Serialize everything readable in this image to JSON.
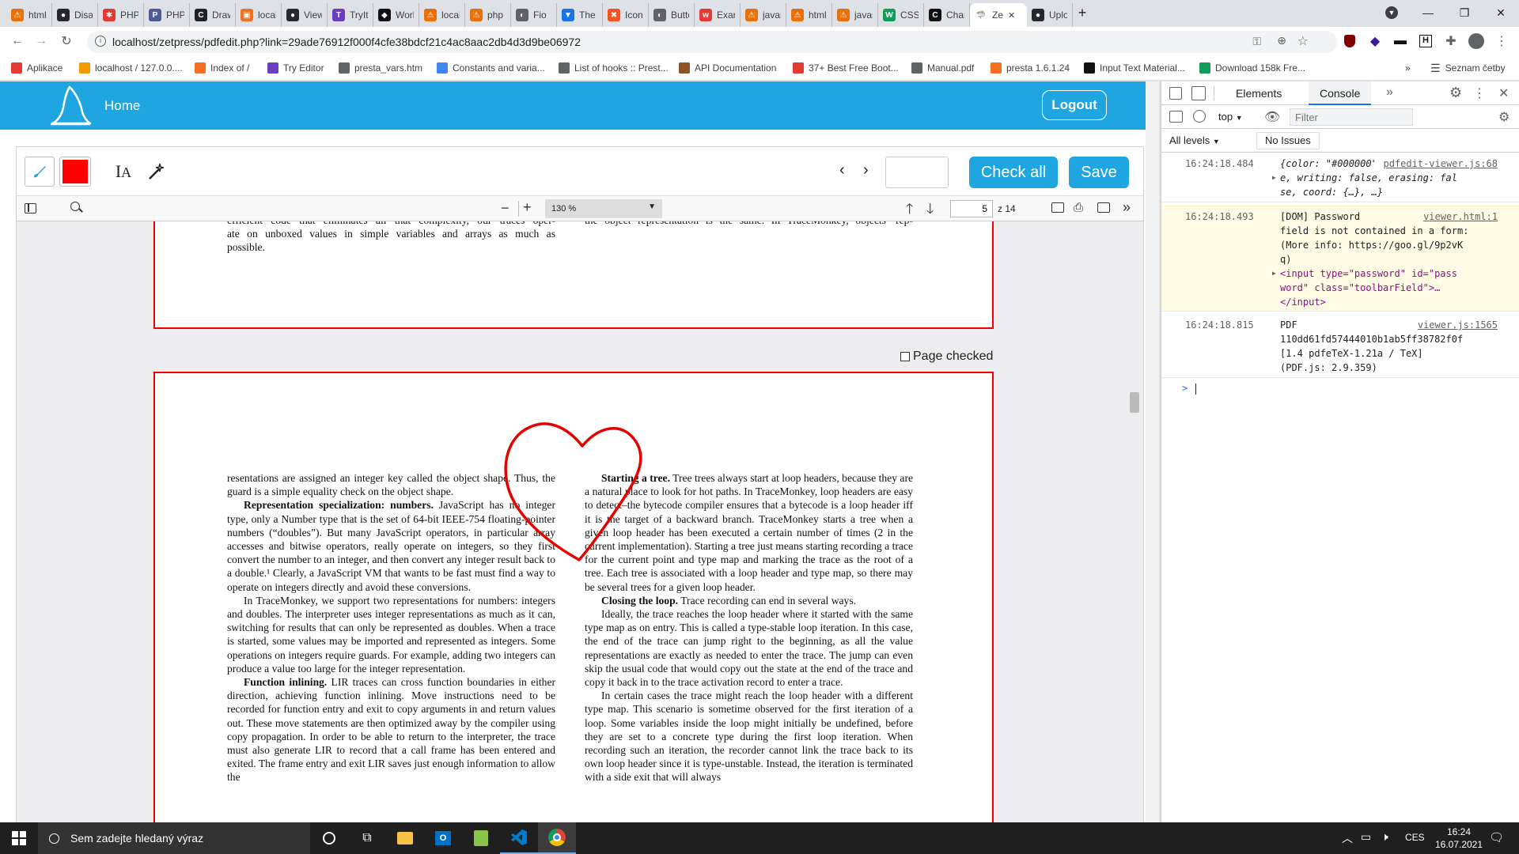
{
  "browser": {
    "tabs": [
      {
        "label": "html -",
        "fav": "#e8710a",
        "glyph": "⚠"
      },
      {
        "label": "Disab",
        "fav": "#24292e",
        "glyph": "●"
      },
      {
        "label": "PHP is",
        "fav": "#e53935",
        "glyph": "✱"
      },
      {
        "label": "PHP: I",
        "fav": "#4f5b93",
        "glyph": "P"
      },
      {
        "label": "Draw",
        "fav": "#202124",
        "glyph": "C"
      },
      {
        "label": "localh",
        "fav": "#f36f21",
        "glyph": "▣"
      },
      {
        "label": "Viewe",
        "fav": "#24292e",
        "glyph": "●"
      },
      {
        "label": "TryIt E",
        "fav": "#6a3fbf",
        "glyph": "T"
      },
      {
        "label": "Worki",
        "fav": "#111111",
        "glyph": "◆"
      },
      {
        "label": "localh",
        "fav": "#e8710a",
        "glyph": "⚠"
      },
      {
        "label": "php -",
        "fav": "#e8710a",
        "glyph": "⚠"
      },
      {
        "label": "Fio",
        "fav": "#5f6368",
        "glyph": "◐"
      },
      {
        "label": "The B",
        "fav": "#1a73e8",
        "glyph": "▼"
      },
      {
        "label": "Icons",
        "fav": "#f4511e",
        "glyph": "✖"
      },
      {
        "label": "Butto",
        "fav": "#5f6368",
        "glyph": "◐"
      },
      {
        "label": "Examp",
        "fav": "#e53935",
        "glyph": "w"
      },
      {
        "label": "javasc",
        "fav": "#e8710a",
        "glyph": "⚠"
      },
      {
        "label": "html -",
        "fav": "#e8710a",
        "glyph": "⚠"
      },
      {
        "label": "javasc",
        "fav": "#e8710a",
        "glyph": "⚠"
      },
      {
        "label": "CSS c",
        "fav": "#0f9d58",
        "glyph": "W"
      },
      {
        "label": "Chang",
        "fav": "#111111",
        "glyph": "C"
      },
      {
        "label": "Ze",
        "fav": "#ffffff",
        "glyph": "🦈",
        "active": true
      },
      {
        "label": "Uploa",
        "fav": "#24292e",
        "glyph": "●"
      }
    ],
    "new_tab": "+",
    "url": "localhost/zetpress/pdfedit.php?link=29ade76912f000f4cfe38bdcf21c4ac8aac2db4d3d9be06972",
    "bookmarks": [
      {
        "label": "Aplikace",
        "color": "#e53935"
      },
      {
        "label": "localhost / 127.0.0....",
        "color": "#f29900"
      },
      {
        "label": "Index of /",
        "color": "#f36f21"
      },
      {
        "label": "Try Editor",
        "color": "#6a3fbf"
      },
      {
        "label": "presta_vars.htm",
        "color": "#5f6368"
      },
      {
        "label": "Constants and varia...",
        "color": "#4285f4"
      },
      {
        "label": "List of hooks :: Prest...",
        "color": "#5f6368"
      },
      {
        "label": "API Documentation",
        "color": "#8d5524"
      },
      {
        "label": "37+ Best Free Boot...",
        "color": "#e53935"
      },
      {
        "label": "Manual.pdf",
        "color": "#5f6368"
      },
      {
        "label": "presta 1.6.1.24",
        "color": "#f36f21"
      },
      {
        "label": "Input Text Material...",
        "color": "#111111"
      },
      {
        "label": "Download 158k Fre...",
        "color": "#0f9d58"
      }
    ],
    "more": "»",
    "reading_list": "Seznam četby"
  },
  "app": {
    "home_label": "Home",
    "logout_label": "Logout",
    "accent": "#1fa6e0",
    "pen_color": "#ff0000",
    "check_all_label": "Check all",
    "save_label": "Save",
    "page_jump_value": ""
  },
  "pdf": {
    "zoom": "130 %",
    "page_number": "5",
    "page_total": "z 14",
    "page_checked_label": "Page checked",
    "prev_page": {
      "left_lines": [
        "efficient code that eliminates all that complexity, our traces oper-",
        "ate on unboxed values in simple variables and arrays as much as",
        "possible."
      ],
      "right_lines": [
        "the object representation is the same. In TraceMonkey, objects’ rep-"
      ]
    },
    "left_col": [
      {
        "type": "p",
        "text": "resentations are assigned an integer key called the object shape. Thus, the guard is a simple equality check on the object shape."
      },
      {
        "type": "h",
        "head": "Representation specialization: numbers.",
        "text": " JavaScript has no integer type, only a Number type that is the set of 64-bit IEEE-754 floating-pointer numbers (“doubles”). But many JavaScript operators, in particular array accesses and bitwise operators, really operate on integers, so they first convert the number to an integer, and then convert any integer result back to a double.¹ Clearly, a JavaScript VM that wants to be fast must find a way to operate on integers directly and avoid these conversions."
      },
      {
        "type": "i",
        "text": "In TraceMonkey, we support two representations for numbers: integers and doubles. The interpreter uses integer representations as much as it can, switching for results that can only be represented as doubles. When a trace is started, some values may be imported and represented as integers. Some operations on integers require guards. For example, adding two integers can produce a value too large for the integer representation."
      },
      {
        "type": "h",
        "head": "Function inlining.",
        "text": " LIR traces can cross function boundaries in either direction, achieving function inlining. Move instructions need to be recorded for function entry and exit to copy arguments in and return values out. These move statements are then optimized away by the compiler using copy propagation. In order to be able to return to the interpreter, the trace must also generate LIR to record that a call frame has been entered and exited. The frame entry and exit LIR saves just enough information to allow the"
      }
    ],
    "right_col": [
      {
        "type": "h",
        "head": "Starting a tree.",
        "text": " Tree trees always start at loop headers, because they are a natural place to look for hot paths. In TraceMonkey, loop headers are easy to detect–the bytecode compiler ensures that a bytecode is a loop header iff it is the target of a backward branch. TraceMonkey starts a tree when a given loop header has been executed a certain number of times (2 in the current implementation). Starting a tree just means starting recording a trace for the current point and type map and marking the trace as the root of a tree. Each tree is associated with a loop header and type map, so there may be several trees for a given loop header."
      },
      {
        "type": "h",
        "head": "Closing the loop.",
        "text": " Trace recording can end in several ways."
      },
      {
        "type": "i",
        "text": "Ideally, the trace reaches the loop header where it started with the same type map as on entry. This is called a type-stable loop iteration. In this case, the end of the trace can jump right to the beginning, as all the value representations are exactly as needed to enter the trace. The jump can even skip the usual code that would copy out the state at the end of the trace and copy it back in to the trace activation record to enter a trace."
      },
      {
        "type": "i",
        "text": "In certain cases the trace might reach the loop header with a different type map. This scenario is sometime observed for the first iteration of a loop. Some variables inside the loop might initially be undefined, before they are set to a concrete type during the first loop iteration. When recording such an iteration, the recorder cannot link the trace back to its own loop header since it is type-unstable. Instead, the iteration is terminated with a side exit that will always"
      }
    ],
    "annotation_color": "#e60000"
  },
  "devtools": {
    "tabs": [
      "Elements",
      "Console"
    ],
    "active_tab": "Console",
    "context": "top",
    "filter_placeholder": "Filter",
    "levels": "All levels",
    "issues": "No Issues",
    "messages": [
      {
        "time": "16:24:18.484",
        "source": "pdfedit-viewer.js:68",
        "lines": [
          "{color: \"#000000\", drawing: tru",
          "e, writing: false, erasing: fal",
          "se, coord: {…}, …}"
        ],
        "kind": "log"
      },
      {
        "time": "16:24:18.493",
        "source": "viewer.html:1",
        "lines": [
          "[DOM] Password",
          "field is not contained in a form:",
          "(More info: https://goo.gl/9p2vK",
          "q)",
          "<input type=\"password\" id=\"pass",
          "word\" class=\"toolbarField\">…",
          "</input>"
        ],
        "kind": "verbose"
      },
      {
        "time": "16:24:18.815",
        "source": "viewer.js:1565",
        "lines": [
          "PDF",
          "110dd61fd57444010b1ab5ff38782f0f",
          "[1.4 pdfeTeX-1.21a / TeX]",
          "(PDF.js: 2.9.359)"
        ],
        "kind": "log"
      }
    ],
    "prompt": ">"
  },
  "taskbar": {
    "search_placeholder": "Sem zadejte hledaný výraz",
    "lang": "CES",
    "time": "16:24",
    "date": "16.07.2021"
  }
}
